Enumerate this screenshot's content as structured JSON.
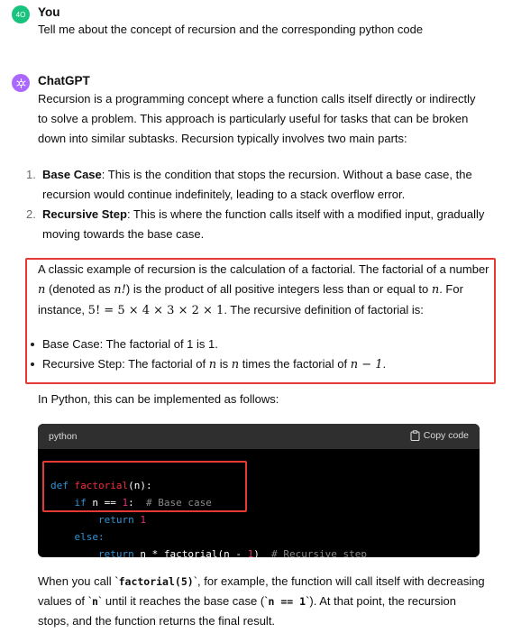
{
  "user": {
    "avatar": "4O",
    "name": "You",
    "message": "Tell me about the concept of recursion and the corresponding python code"
  },
  "assistant": {
    "name": "ChatGPT",
    "intro": [
      "Recursion is a programming concept where a function calls itself directly or indirectly",
      "to solve a problem. This approach is particularly useful for tasks that can be broken",
      "down into similar subtasks. Recursion typically involves two main parts:"
    ],
    "list": [
      {
        "num": "1.",
        "term": "Base Case",
        "text1": ": This is the condition that stops the recursion. Without a base case, the",
        "text2": "recursion would continue indefinitely, leading to a stack overflow error."
      },
      {
        "num": "2.",
        "term": "Recursive Step",
        "text1": ": This is where the function calls itself with a modified input, gradually",
        "text2": "moving towards the base case."
      }
    ],
    "example": {
      "l1": "A classic example of recursion is the calculation of a factorial. The factorial of a number",
      "l2a": "(denoted as",
      "l2b": ") is the product of all positive integers less than or equal to",
      "l2c": ". For",
      "l3a": "instance,",
      "l3b": ". The recursive definition of factorial is:",
      "b1": "Base Case: The factorial of 1 is 1.",
      "b2a": "Recursive Step: The factorial of",
      "b2b": "is",
      "b2c": "times the factorial of",
      "b2d": "."
    },
    "math": {
      "n": "n",
      "nfact": "n!",
      "eq": "5! = 5 × 4 × 3 × 2 × 1",
      "nminus1": "n − 1"
    },
    "python_intro": "In Python, this can be implemented as follows:",
    "code": {
      "lang": "python",
      "copy": "Copy code",
      "tokens": {
        "def": "def",
        "fname": "factorial",
        "sig": "(n):",
        "if": "if",
        "cond": " n == ",
        "one": "1",
        "colon": ":  ",
        "c1": "# Base case",
        "ret": "return",
        "one2": "1",
        "else": "else:",
        "ret2": "return",
        "expr1": " n * factorial(n - ",
        "one3": "1",
        "expr2": ")  ",
        "c2": "# Recursive step"
      }
    },
    "outro": {
      "l1a": "When you call `",
      "l1code": "factorial(5)",
      "l1b": "`, for example, the function will call itself with decreasing",
      "l2a": "values of `",
      "l2code": "n",
      "l2b": "` until it reaches the base case (`",
      "l2code2": "n == 1",
      "l2c": "`). At that point, the recursion",
      "l3": "stops, and the function returns the final result."
    }
  },
  "colors": {
    "user_avatar": "#19c37d",
    "gpt_avatar": "#ab68ff",
    "highlight": "#e53935"
  }
}
